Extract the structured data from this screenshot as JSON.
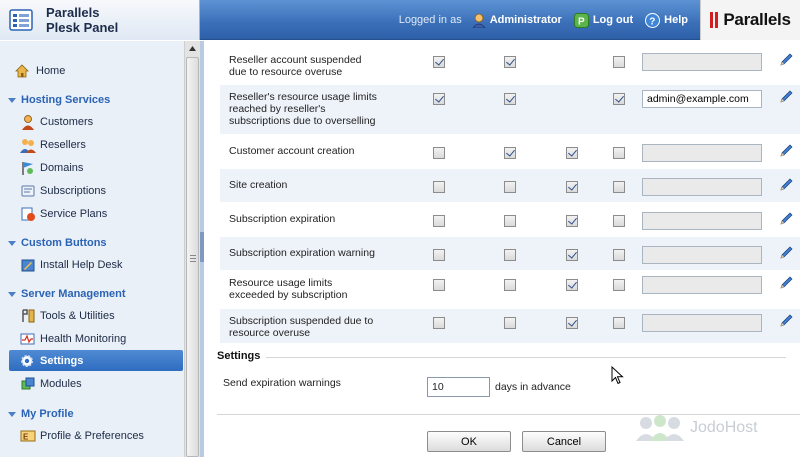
{
  "header": {
    "brand_line1": "Parallels",
    "brand_line2": "Plesk Panel",
    "logged_in_as": "Logged in as",
    "user_name": "Administrator",
    "logout_label": "Log out",
    "help_label": "Help",
    "logo_text": "Parallels"
  },
  "sidebar": {
    "home": "Home",
    "sections": [
      {
        "title": "Hosting Services",
        "items": [
          "Customers",
          "Resellers",
          "Domains",
          "Subscriptions",
          "Service Plans"
        ]
      },
      {
        "title": "Custom Buttons",
        "items": [
          "Install Help Desk"
        ]
      },
      {
        "title": "Server Management",
        "items": [
          "Tools & Utilities",
          "Health Monitoring",
          "Settings",
          "Modules"
        ]
      },
      {
        "title": "My Profile",
        "items": [
          "Profile & Preferences"
        ]
      }
    ],
    "selected_item": "Settings"
  },
  "notifications": [
    {
      "name_line1": "Reseller account suspended",
      "name_line2": "due to resource overuse",
      "name_line3": "",
      "c1": true,
      "c2": true,
      "c3": null,
      "c4": false,
      "email": ""
    },
    {
      "name_line1": "Reseller's resource usage limits",
      "name_line2": "reached by reseller's",
      "name_line3": "subscriptions due to overselling",
      "c1": true,
      "c2": true,
      "c3": null,
      "c4": true,
      "email": "admin@example.com"
    },
    {
      "name_line1": "Customer account creation",
      "name_line2": "",
      "name_line3": "",
      "c1": false,
      "c2": true,
      "c3": true,
      "c4": false,
      "email": ""
    },
    {
      "name_line1": "Site creation",
      "name_line2": "",
      "name_line3": "",
      "c1": false,
      "c2": false,
      "c3": true,
      "c4": false,
      "email": ""
    },
    {
      "name_line1": "Subscription expiration",
      "name_line2": "",
      "name_line3": "",
      "c1": false,
      "c2": false,
      "c3": true,
      "c4": false,
      "email": ""
    },
    {
      "name_line1": "Subscription expiration warning",
      "name_line2": "",
      "name_line3": "",
      "c1": false,
      "c2": false,
      "c3": true,
      "c4": false,
      "email": ""
    },
    {
      "name_line1": "Resource usage limits",
      "name_line2": "exceeded by subscription",
      "name_line3": "",
      "c1": false,
      "c2": false,
      "c3": true,
      "c4": false,
      "email": ""
    },
    {
      "name_line1": "Subscription suspended due to",
      "name_line2": "resource overuse",
      "name_line3": "",
      "c1": false,
      "c2": false,
      "c3": true,
      "c4": false,
      "email": ""
    }
  ],
  "settings": {
    "title": "Settings",
    "warn_label": "Send expiration warnings",
    "days_value": "10",
    "days_label": "days in advance"
  },
  "buttons": {
    "ok": "OK",
    "cancel": "Cancel"
  },
  "watermark": "JodoHost",
  "colors": {
    "header_blue": "#3a6fb8",
    "section_blue": "#2b63b5",
    "selected_bg": "#2f6dc1",
    "row_alt": "#eef3fa"
  }
}
